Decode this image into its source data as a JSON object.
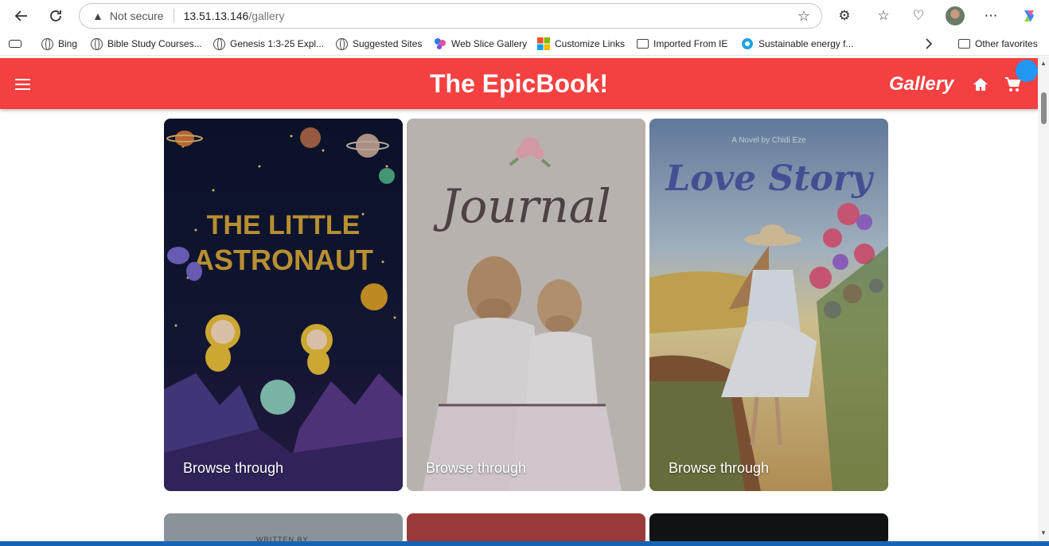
{
  "browser": {
    "address": {
      "security": "Not secure",
      "host": "13.51.13.146",
      "path": "/gallery"
    },
    "bookmarks": [
      {
        "label": "Bing",
        "icon": "globe-icon"
      },
      {
        "label": "Bible Study Courses...",
        "icon": "globe-icon"
      },
      {
        "label": "Genesis 1:3-25 Expl...",
        "icon": "globe-icon"
      },
      {
        "label": "Suggested Sites",
        "icon": "globe-icon"
      },
      {
        "label": "Web Slice Gallery",
        "icon": "web-slice-icon"
      },
      {
        "label": "Customize Links",
        "icon": "windows-logo-icon"
      },
      {
        "label": "Imported From IE",
        "icon": "folder-icon"
      },
      {
        "label": "Sustainable energy f...",
        "icon": "web-icon"
      }
    ],
    "other_favorites": "Other favorites"
  },
  "header": {
    "title": "The EpicBook!",
    "gallery_link": "Gallery",
    "colors": {
      "bar": "#f44040",
      "badge": "#2196f3"
    }
  },
  "books": [
    {
      "cover_title": "THE LITTLE ASTRONAUT",
      "action": "Browse through"
    },
    {
      "cover_title": "Journal",
      "action": "Browse through"
    },
    {
      "cover_title": "Love Story",
      "cover_subtitle": "A Novel by Chidi Eze",
      "action": "Browse through"
    }
  ],
  "next_row_partial_text": "WRITTEN BY"
}
